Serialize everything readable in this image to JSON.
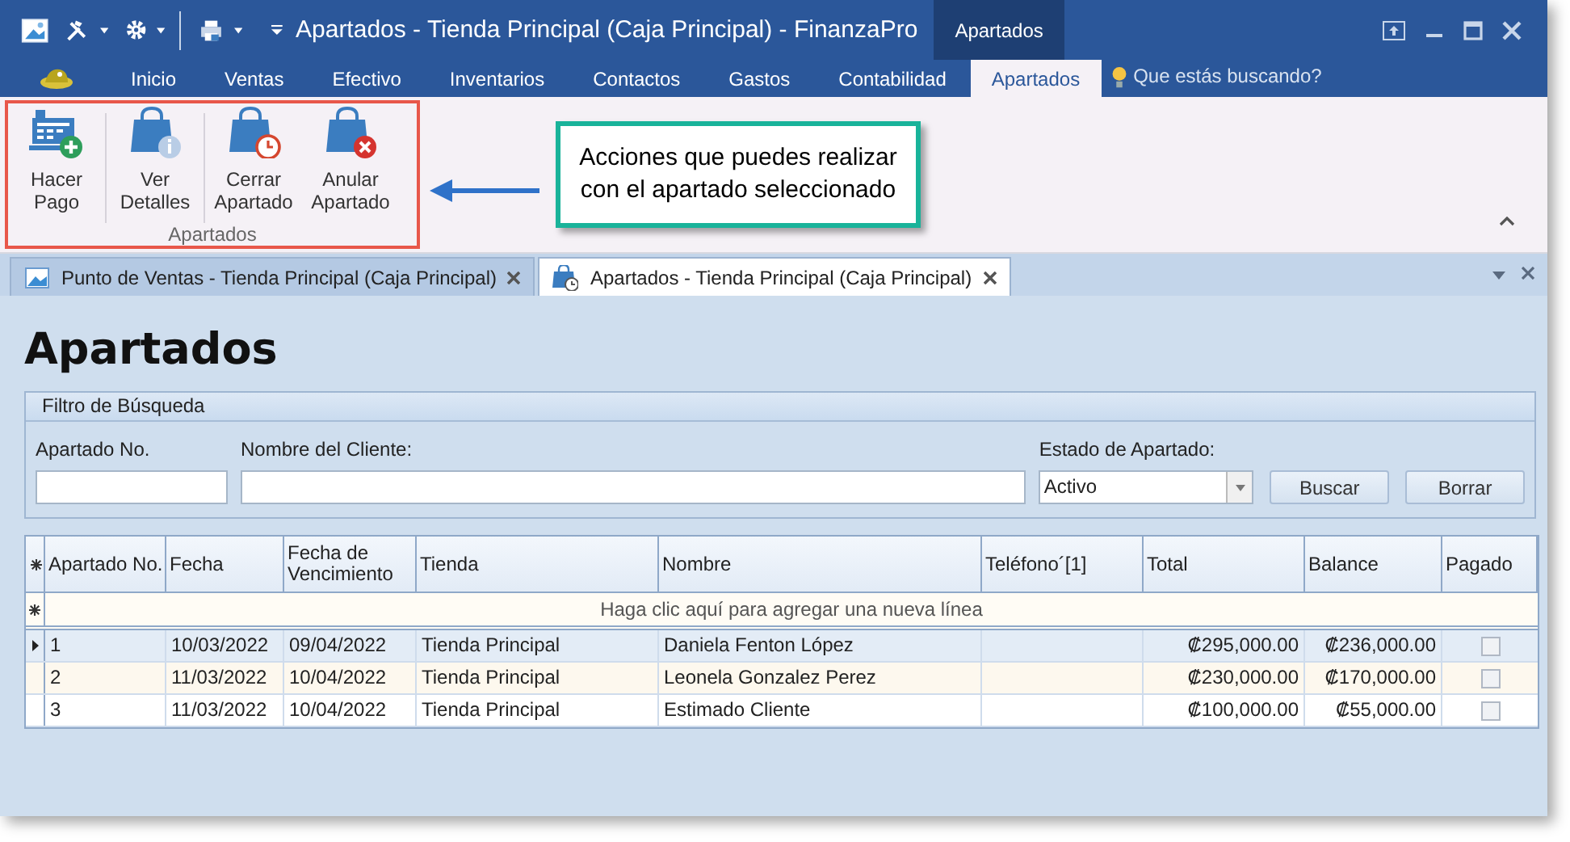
{
  "window": {
    "title": "Apartados - Tienda Principal (Caja Principal) - FinanzaPro",
    "context_tab": "Apartados"
  },
  "ribbon": {
    "tabs": [
      {
        "label": "Inicio",
        "selected": false
      },
      {
        "label": "Ventas",
        "selected": false
      },
      {
        "label": "Efectivo",
        "selected": false
      },
      {
        "label": "Inventarios",
        "selected": false
      },
      {
        "label": "Contactos",
        "selected": false
      },
      {
        "label": "Gastos",
        "selected": false
      },
      {
        "label": "Contabilidad",
        "selected": false
      },
      {
        "label": "Apartados",
        "selected": true
      }
    ],
    "search_placeholder": "Que estás buscando?",
    "group": {
      "label": "Apartados",
      "buttons": [
        {
          "label": "Hacer Pago",
          "kind": "register"
        },
        {
          "label": "Ver Detalles",
          "kind": "info"
        },
        {
          "label": "Cerrar Apartado",
          "kind": "clock"
        },
        {
          "label": "Anular Apartado",
          "kind": "cancel"
        }
      ]
    }
  },
  "annotation": {
    "text": "Acciones que puedes realizar con el apartado seleccionado"
  },
  "document_tabs": [
    {
      "label": "Punto de Ventas - Tienda Principal (Caja Principal)",
      "kind": "sales",
      "selected": false
    },
    {
      "label": "Apartados - Tienda Principal (Caja Principal)",
      "kind": "bag",
      "selected": true
    }
  ],
  "heading": "Apartados",
  "filter": {
    "title": "Filtro de Búsqueda",
    "fields": [
      {
        "label": "Apartado No.",
        "kind": "text"
      },
      {
        "label": "Nombre del Cliente:",
        "kind": "text"
      },
      {
        "label": "Estado de Apartado:",
        "kind": "select",
        "value": "Activo"
      }
    ],
    "buttons": [
      "Buscar",
      "Borrar"
    ]
  },
  "table": {
    "columns": [
      "Apartado No.",
      "Fecha",
      "Fecha de Vencimiento",
      "Tienda",
      "Nombre",
      "Teléfono´[1]",
      "Total",
      "Balance",
      "Pagado"
    ],
    "new_row_text": "Haga clic aquí para agregar una nueva línea",
    "rows": [
      {
        "selected": true,
        "cells": [
          "1",
          "10/03/2022",
          "09/04/2022",
          "Tienda Principal",
          "Daniela Fenton López",
          "",
          "₡295,000.00",
          "₡236,000.00"
        ],
        "pagado": false
      },
      {
        "selected": false,
        "cells": [
          "2",
          "11/03/2022",
          "10/04/2022",
          "Tienda Principal",
          "Leonela Gonzalez Perez",
          "",
          "₡230,000.00",
          "₡170,000.00"
        ],
        "pagado": false
      },
      {
        "selected": false,
        "cells": [
          "3",
          "11/03/2022",
          "10/04/2022",
          "Tienda Principal",
          "Estimado Cliente",
          "",
          "₡100,000.00",
          "₡55,000.00"
        ],
        "pagado": false
      }
    ]
  }
}
